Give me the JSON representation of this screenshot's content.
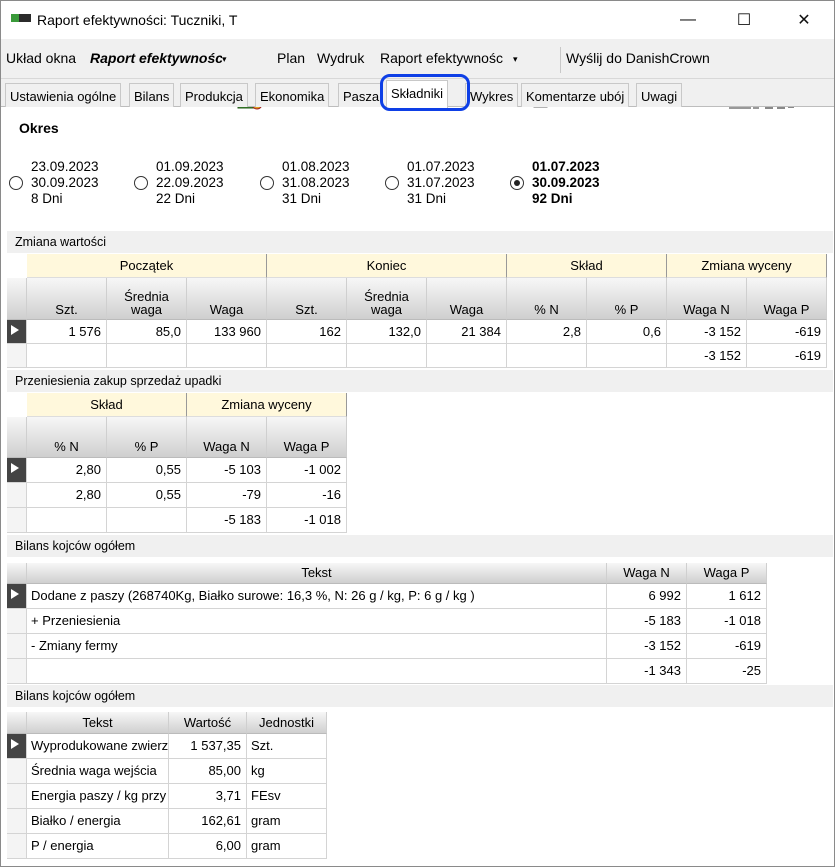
{
  "window": {
    "title": "Raport efektywności: Tuczniki, T",
    "minimize": "—",
    "maximize": "☐",
    "close": "✕"
  },
  "toolbar": {
    "layout_label": "Układ okna",
    "layout_value": "Raport efektywnośc",
    "plan": "Plan",
    "print": "Wydruk",
    "print_value": "Raport efektywnośc",
    "send": "Wyślij do DanishCrown"
  },
  "tabs": [
    "Ustawienia ogólne",
    "Bilans",
    "Produkcja",
    "Ekonomika",
    "Pasza",
    "Składniki",
    "Wykres",
    "Komentarze ubój",
    "Uwagi"
  ],
  "okres": {
    "title": "Okres",
    "options": [
      {
        "line1": "23.09.2023",
        "line2": "30.09.2023",
        "line3": "8 Dni",
        "selected": false
      },
      {
        "line1": "01.09.2023",
        "line2": "22.09.2023",
        "line3": "22 Dni",
        "selected": false
      },
      {
        "line1": "01.08.2023",
        "line2": "31.08.2023",
        "line3": "31 Dni",
        "selected": false
      },
      {
        "line1": "01.07.2023",
        "line2": "31.07.2023",
        "line3": "31 Dni",
        "selected": false
      },
      {
        "line1": "01.07.2023",
        "line2": "30.09.2023",
        "line3": "92 Dni",
        "selected": true
      }
    ]
  },
  "zmiana": {
    "title": "Zmiana wartości",
    "groups": [
      "Początek",
      "Koniec",
      "Skład",
      "Zmiana wyceny"
    ],
    "cols": [
      "Szt.",
      "Średnia waga",
      "Waga",
      "Szt.",
      "Średnia waga",
      "Waga",
      "% N",
      "% P",
      "Waga N",
      "Waga P"
    ],
    "rows": [
      [
        "1 576",
        "85,0",
        "133 960",
        "162",
        "132,0",
        "21 384",
        "2,8",
        "0,6",
        "-3 152",
        "-619"
      ],
      [
        "",
        "",
        "",
        "",
        "",
        "",
        "",
        "",
        "-3 152",
        "-619"
      ]
    ]
  },
  "przeniesienia": {
    "title": "Przeniesienia zakup sprzedaż upadki",
    "groups": [
      "Skład",
      "Zmiana wyceny"
    ],
    "cols": [
      "% N",
      "% P",
      "Waga N",
      "Waga P"
    ],
    "rows": [
      [
        "2,80",
        "0,55",
        "-5 103",
        "-1 002"
      ],
      [
        "2,80",
        "0,55",
        "-79",
        "-16"
      ],
      [
        "",
        "",
        "-5 183",
        "-1 018"
      ]
    ]
  },
  "bilans1": {
    "title": "Bilans kojców ogółem",
    "cols": [
      "Tekst",
      "Waga N",
      "Waga P"
    ],
    "rows": [
      [
        "Dodane z paszy (268740Kg, Białko surowe: 16,3 %, N: 26 g / kg, P: 6 g / kg )",
        "6 992",
        "1 612"
      ],
      [
        "+ Przeniesienia",
        "-5 183",
        "-1 018"
      ],
      [
        "- Zmiany fermy",
        "-3 152",
        "-619"
      ],
      [
        "",
        "-1 343",
        "-25"
      ]
    ]
  },
  "bilans2": {
    "title": "Bilans kojców ogółem",
    "cols": [
      "Tekst",
      "Wartość",
      "Jednostki"
    ],
    "rows": [
      [
        "Wyprodukowane zwierz",
        "1 537,35",
        "Szt."
      ],
      [
        "Średnia waga wejścia",
        "85,00",
        "kg"
      ],
      [
        "Energia paszy / kg przy",
        "3,71",
        "FEsv"
      ],
      [
        "Białko / energia",
        "162,61",
        "gram"
      ],
      [
        "P / energia",
        "6,00",
        "gram"
      ]
    ]
  }
}
